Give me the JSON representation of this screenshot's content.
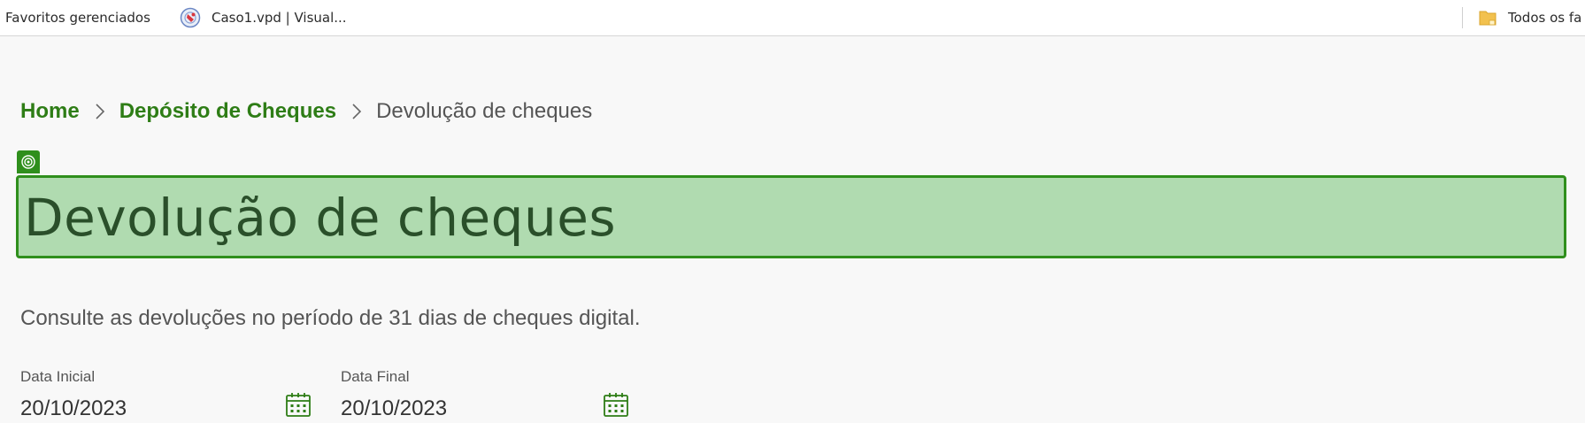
{
  "bookmarks": {
    "managed_label": "Favoritos gerenciados",
    "caso_label": "Caso1.vpd | Visual...",
    "all_label": "Todos os fa"
  },
  "breadcrumb": {
    "home": "Home",
    "deposito": "Depósito de Cheques",
    "current": "Devolução de cheques"
  },
  "page": {
    "title": "Devolução de cheques",
    "description": "Consulte as devoluções no período de 31 dias de cheques digital."
  },
  "filters": {
    "initial": {
      "label": "Data Inicial",
      "value": "20/10/2023"
    },
    "final": {
      "label": "Data Final",
      "value": "20/10/2023"
    }
  },
  "colors": {
    "accent_green": "#2e7d16",
    "highlight_fill": "#b0dbb0",
    "highlight_border": "#2f8f1c",
    "title_text": "#2a4f2a"
  },
  "icons": {
    "site": "site-favicon-icon",
    "folder": "folder-icon",
    "breadcrumb_separator": "chevron-right-icon",
    "title_marker": "target-icon",
    "calendar": "calendar-icon"
  }
}
